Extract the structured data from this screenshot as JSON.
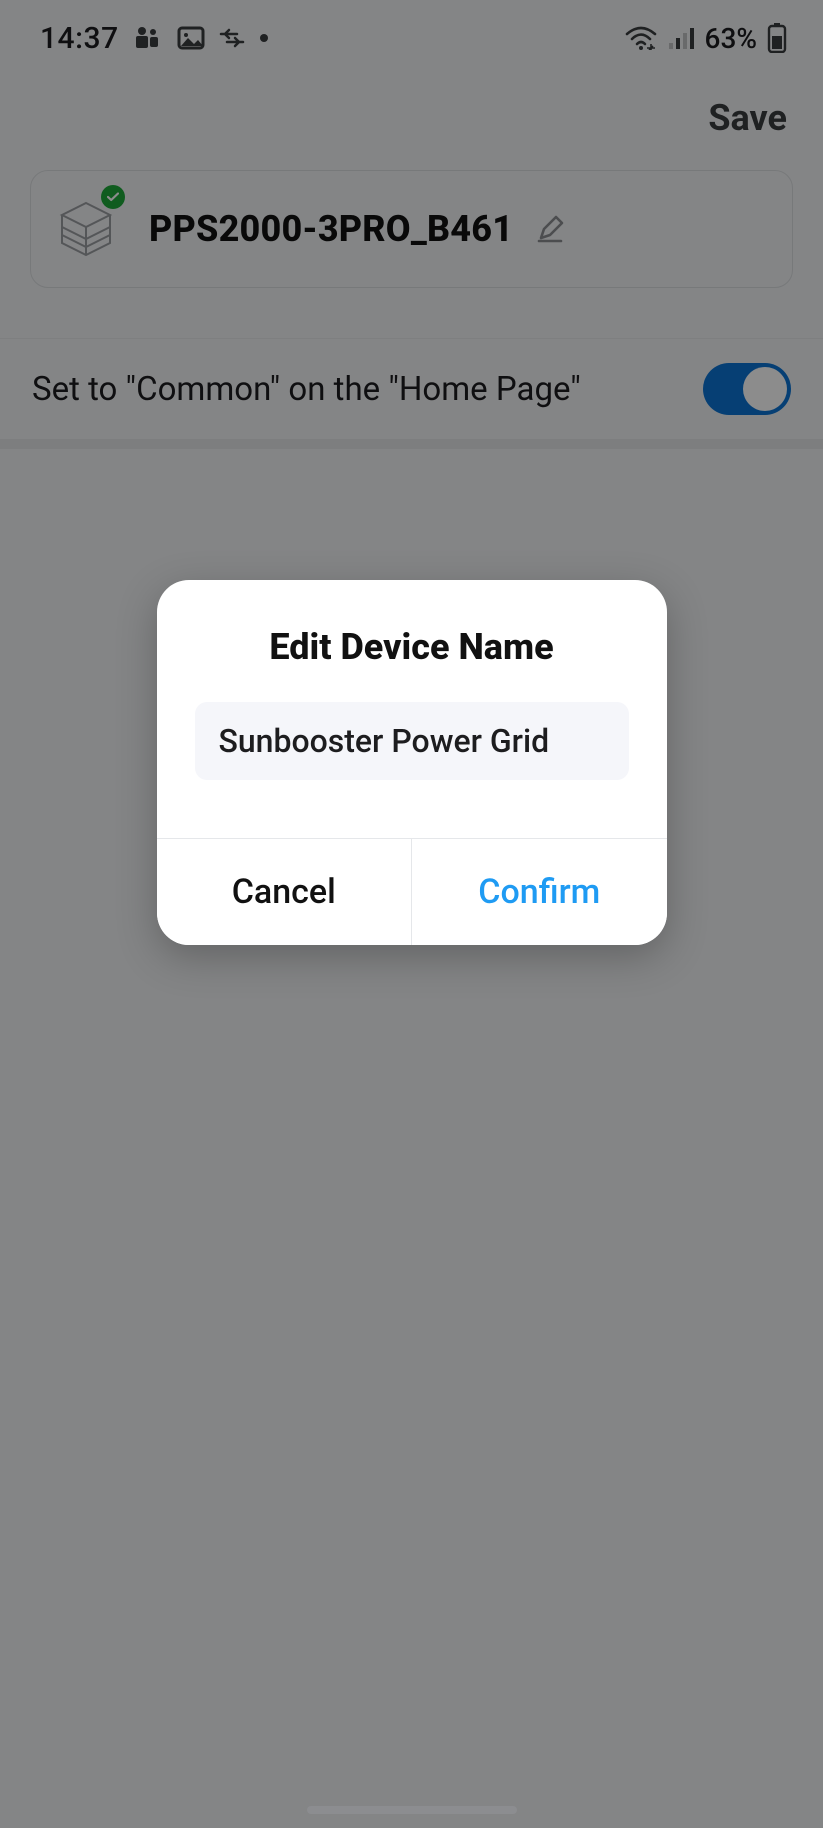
{
  "status_bar": {
    "time": "14:37",
    "battery_percent": "63%"
  },
  "header": {
    "save_label": "Save"
  },
  "device_card": {
    "name": "PPS2000-3PRO_B461"
  },
  "settings": {
    "common_home_label": "Set to \"Common\" on the \"Home Page\"",
    "common_home_enabled": true
  },
  "dialog": {
    "title": "Edit Device Name",
    "input_value": "Sunbooster Power Grid",
    "cancel_label": "Cancel",
    "confirm_label": "Confirm"
  }
}
